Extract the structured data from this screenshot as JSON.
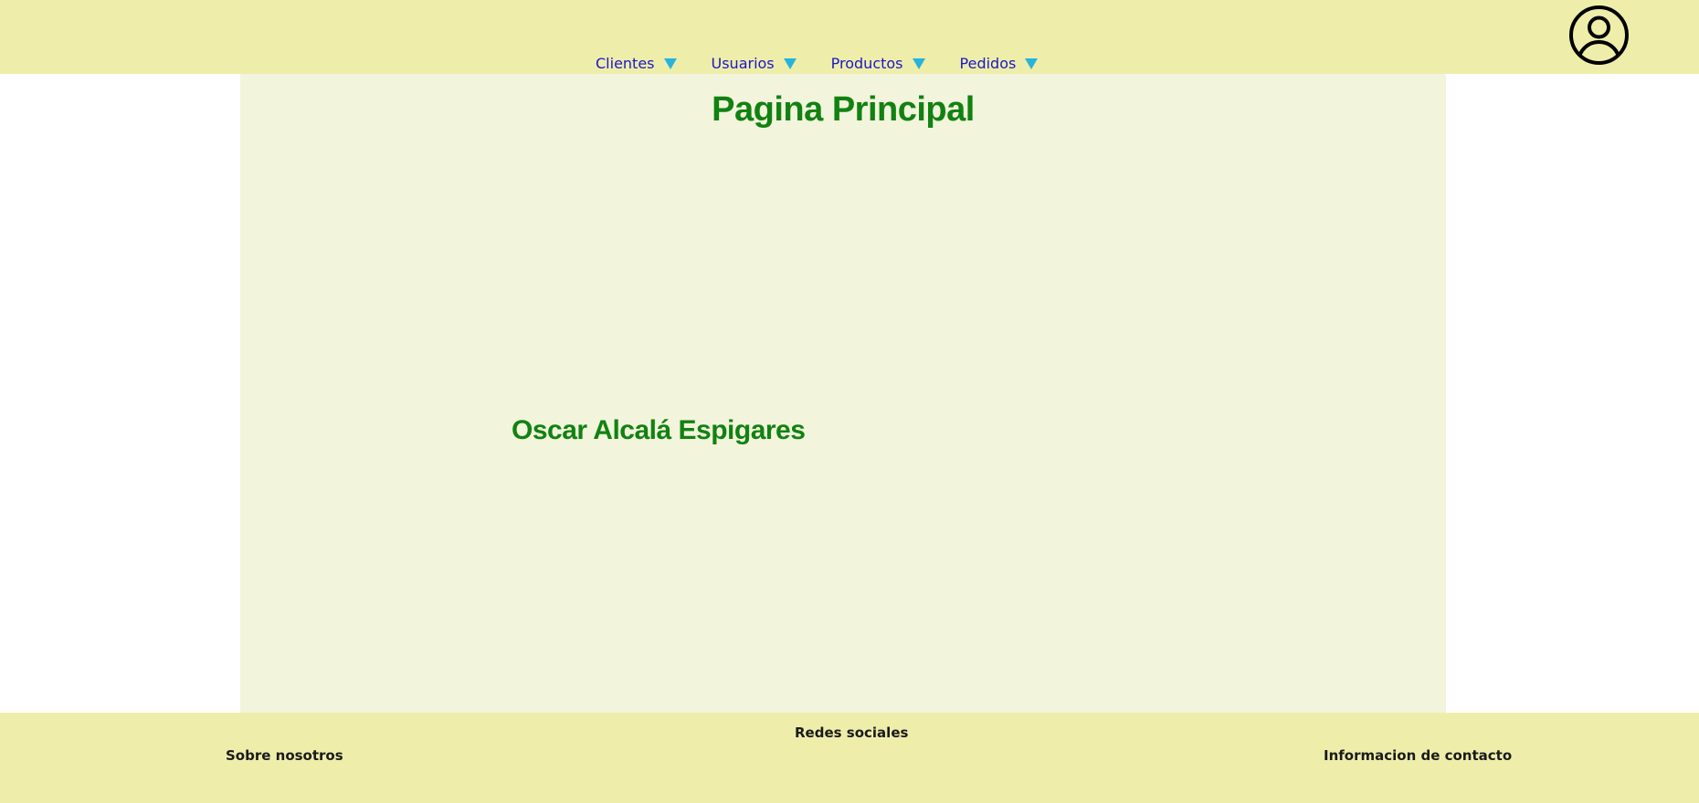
{
  "header": {
    "nav": [
      {
        "label": "Clientes"
      },
      {
        "label": "Usuarios"
      },
      {
        "label": "Productos"
      },
      {
        "label": "Pedidos"
      }
    ],
    "user_icon": "user-circle-icon",
    "arrow_icon": "triangle-down-icon",
    "colors": {
      "background": "#eeeeaa",
      "nav_text": "#1c17c8",
      "arrow": "#27b4dc"
    }
  },
  "main": {
    "title": "Pagina Principal",
    "author": "Oscar Alcalá Espigares",
    "colors": {
      "background": "#f3f4dc",
      "heading": "#118211"
    }
  },
  "footer": {
    "about": "Sobre nosotros",
    "social": "Redes sociales",
    "contact": "Informacion de contacto",
    "colors": {
      "background": "#eeeeaa"
    }
  }
}
